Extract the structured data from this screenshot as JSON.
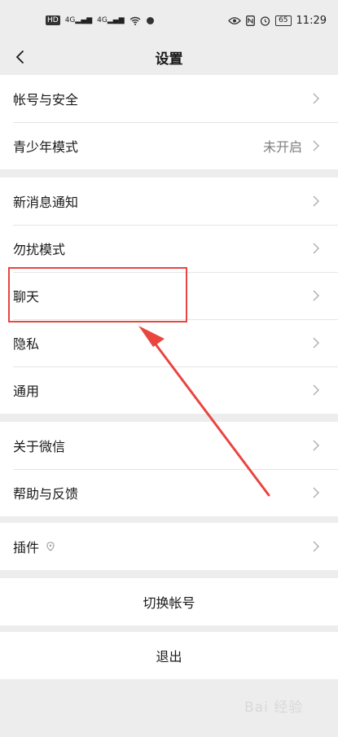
{
  "status": {
    "hd": "HD",
    "net1": "4G",
    "net2": "4G",
    "battery": "65",
    "time": "11:29"
  },
  "nav": {
    "title": "设置"
  },
  "groups": [
    {
      "items": [
        {
          "label": "帐号与安全"
        },
        {
          "label": "青少年模式",
          "value": "未开启"
        }
      ]
    },
    {
      "items": [
        {
          "label": "新消息通知"
        },
        {
          "label": "勿扰模式"
        },
        {
          "label": "聊天"
        },
        {
          "label": "隐私"
        },
        {
          "label": "通用"
        }
      ]
    },
    {
      "items": [
        {
          "label": "关于微信"
        },
        {
          "label": "帮助与反馈"
        }
      ]
    },
    {
      "items": [
        {
          "label": "插件"
        }
      ]
    }
  ],
  "actions": {
    "switch_account": "切换帐号",
    "logout": "退出"
  },
  "watermark": "Bai 经验",
  "colors": {
    "highlight": "#e8463f"
  }
}
